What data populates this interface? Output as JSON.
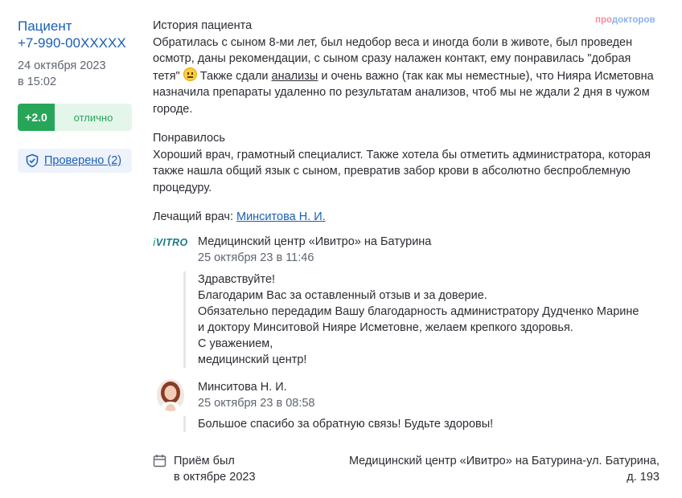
{
  "patient": {
    "name": "Пациент",
    "phone": "+7-990-00XXXXX",
    "date": "24 октября 2023",
    "time": "в 15:02"
  },
  "rating": {
    "score": "+2.0",
    "word": "отлично"
  },
  "verified": {
    "label": "Проверено (2)"
  },
  "brand": {
    "part1": "про",
    "part2": "докторов"
  },
  "history": {
    "title": "История пациента",
    "text_1": "Обратилась с сыном 8-ми лет, был недобор веса и иногда боли в животе, был проведен осмотр, даны рекомендации, с сыном сразу налажен контакт, ему понравилась \"добрая тетя\"",
    "text_2": " Также сдали ",
    "link": "анализы",
    "text_3": " и очень важно (так как мы неместные), что Нияра Исметовна назначила препараты удаленно по результатам анализов, чтоб мы не ждали 2 дня в чужом городе."
  },
  "liked": {
    "title": "Понравилось",
    "text": "Хороший врач, грамотный специалист. Также хотела бы отметить администратора, которая также нашла общий язык с сыном, превратив забор крови в абсолютно беспроблемную процедуру."
  },
  "doctor": {
    "label": "Лечащий врач: ",
    "name": "Минситова Н. И."
  },
  "clinic_reply": {
    "logo": "iVITRO",
    "author": "Медицинский центр «Ивитро» на Батурина",
    "date": "25 октября 23 в 11:46",
    "lines": [
      "Здравствуйте!",
      "Благодарим Вас за оставленный отзыв и за доверие.",
      "Обязательно передадим Вашу благодарность администратору Дудченко Марине",
      "и доктору Минситовой Нияре Исметовне, желаем крепкого здоровья.",
      "С уважением,",
      "медицинский центр!"
    ]
  },
  "doctor_reply": {
    "author": "Минситова Н. И.",
    "date": "25 октября 23 в 08:58",
    "text": "Большое спасибо за обратную связь! Будьте здоровы!"
  },
  "footer": {
    "visit_line1": "Приём был",
    "visit_line2": "в октябре 2023",
    "location_line1": "Медицинский центр «Ивитро» на Батурина-ул. Батурина,",
    "location_line2": "д. 193"
  }
}
